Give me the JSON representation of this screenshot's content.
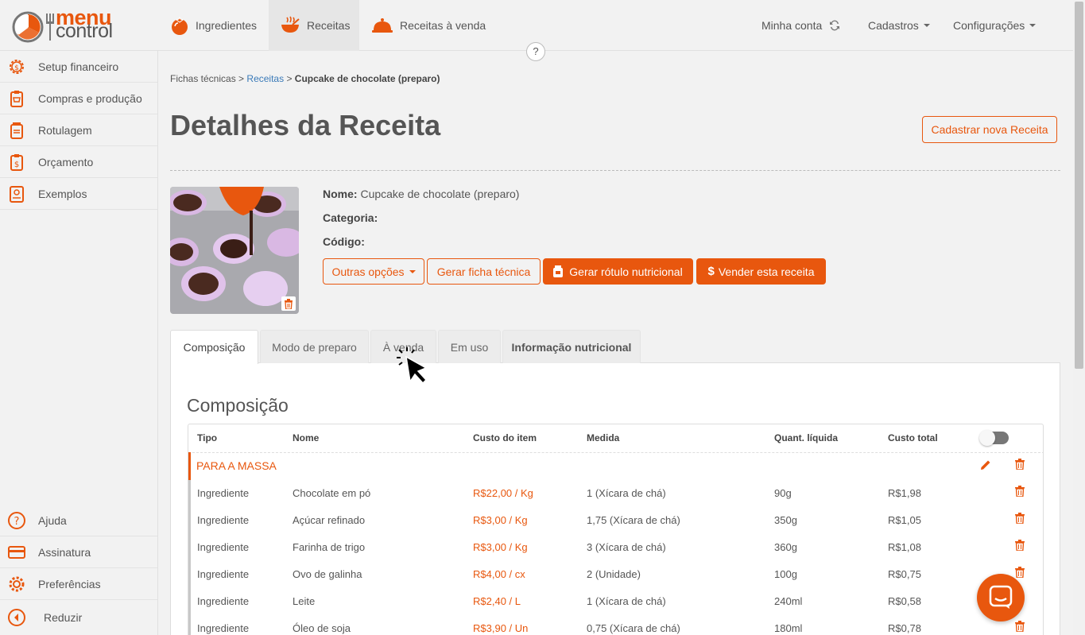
{
  "brand": {
    "line1": "menu",
    "line2": "control",
    "accent": "#e8570e"
  },
  "nav": {
    "ingredientes": "Ingredientes",
    "receitas": "Receitas",
    "receitas_venda": "Receitas à venda",
    "minha_conta": "Minha conta",
    "cadastros": "Cadastros",
    "configuracoes": "Configurações",
    "help": "?"
  },
  "sidebar": {
    "items": [
      {
        "label": "Setup financeiro",
        "icon": "gear-dollar-icon"
      },
      {
        "label": "Compras e produção",
        "icon": "shopping-list-icon"
      },
      {
        "label": "Rotulagem",
        "icon": "label-jar-icon"
      },
      {
        "label": "Orçamento",
        "icon": "budget-clipboard-icon"
      },
      {
        "label": "Exemplos",
        "icon": "examples-book-icon"
      }
    ],
    "bottom": [
      {
        "label": "Ajuda",
        "icon": "help-icon"
      },
      {
        "label": "Assinatura",
        "icon": "credit-card-icon"
      },
      {
        "label": "Preferências",
        "icon": "gear-icon"
      },
      {
        "label": "Reduzir",
        "icon": "collapse-icon"
      }
    ]
  },
  "breadcrumb": {
    "part1": "Fichas técnicas",
    "sep": ">",
    "link": "Receitas",
    "current": "Cupcake de chocolate (preparo)"
  },
  "page": {
    "title": "Detalhes da Receita",
    "new_button": "Cadastrar nova Receita"
  },
  "recipe": {
    "name_label": "Nome:",
    "name": "Cupcake de chocolate (preparo)",
    "category_label": "Categoria:",
    "category": "",
    "code_label": "Código:",
    "code": ""
  },
  "actions": {
    "more": "Outras opções",
    "sheet": "Gerar ficha técnica",
    "label": "Gerar rótulo nutricional",
    "sell": "Vender esta receita"
  },
  "tabs": [
    "Composição",
    "Modo de preparo",
    "À venda",
    "Em uso",
    "Informação nutricional"
  ],
  "composition": {
    "title": "Composição",
    "columns": [
      "Tipo",
      "Nome",
      "Custo do item",
      "Medida",
      "Quant. líquida",
      "Custo total"
    ],
    "group": "PARA A MASSA",
    "rows": [
      {
        "type": "Ingrediente",
        "name": "Chocolate em pó",
        "cost": "R$22,00 / Kg",
        "measure": "1 (Xícara de chá)",
        "qty": "90g",
        "total": "R$1,98"
      },
      {
        "type": "Ingrediente",
        "name": "Açúcar refinado",
        "cost": "R$3,00 / Kg",
        "measure": "1,75 (Xícara de chá)",
        "qty": "350g",
        "total": "R$1,05"
      },
      {
        "type": "Ingrediente",
        "name": "Farinha de trigo",
        "cost": "R$3,00 / Kg",
        "measure": "3 (Xícara de chá)",
        "qty": "360g",
        "total": "R$1,08"
      },
      {
        "type": "Ingrediente",
        "name": "Ovo de galinha",
        "cost": "R$4,00 / cx",
        "measure": "2 (Unidade)",
        "qty": "100g",
        "total": "R$0,75"
      },
      {
        "type": "Ingrediente",
        "name": "Leite",
        "cost": "R$2,40 / L",
        "measure": "1 (Xícara de chá)",
        "qty": "240ml",
        "total": "R$0,58"
      },
      {
        "type": "Ingrediente",
        "name": "Óleo de soja",
        "cost": "R$3,90 / Un",
        "measure": "0,75 (Xícara de chá)",
        "qty": "180ml",
        "total": "R$0,78"
      }
    ]
  }
}
